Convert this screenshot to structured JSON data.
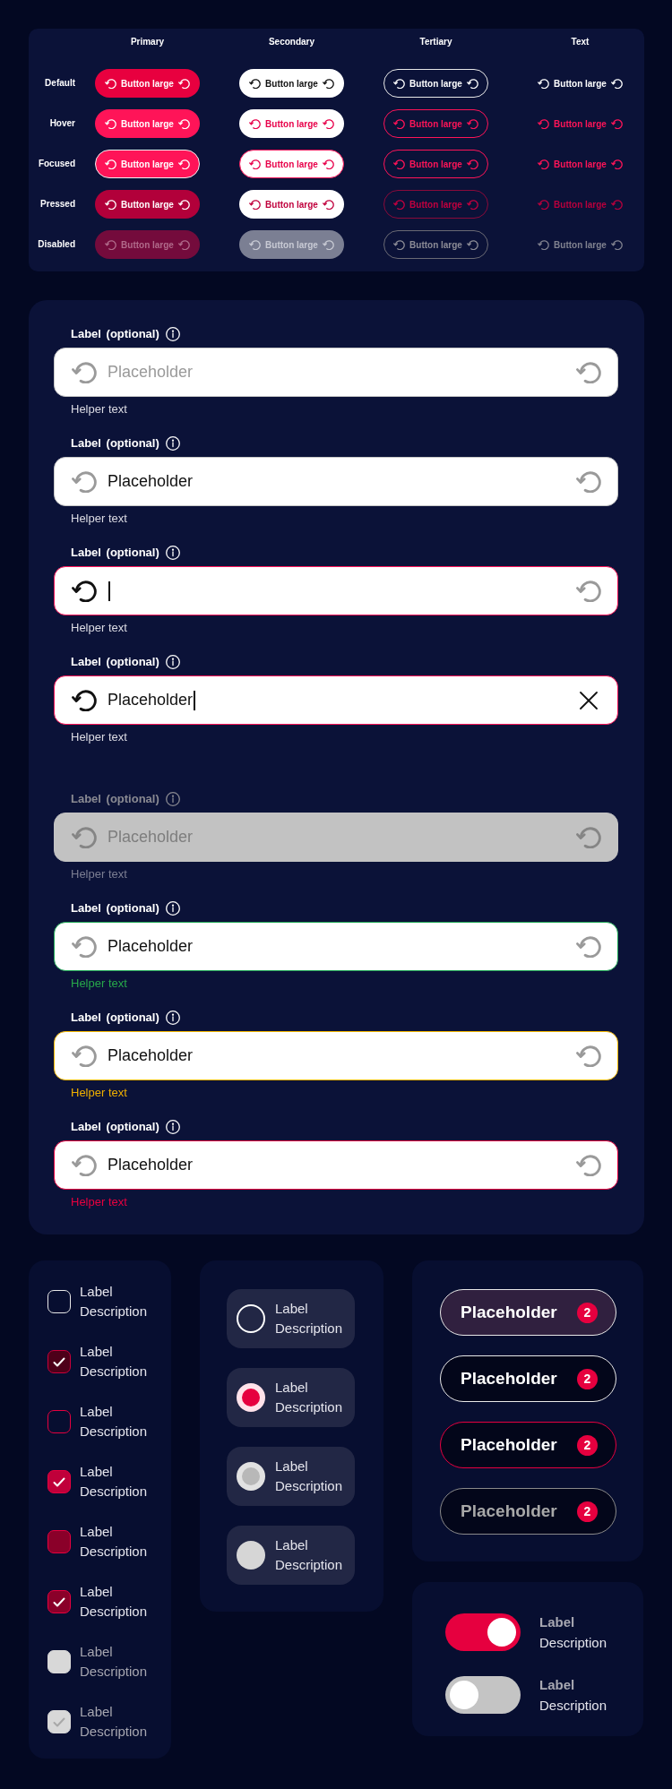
{
  "button_matrix": {
    "columns": [
      {
        "title": "Primary",
        "kind": "primary"
      },
      {
        "title": "Secondary",
        "kind": "secondary"
      },
      {
        "title": "Tertiary",
        "kind": "tertiary"
      },
      {
        "title": "Text",
        "kind": "text"
      }
    ],
    "rows": [
      {
        "label": "Default",
        "kind": "default",
        "buttons": [
          "Button large",
          "Button large",
          "Button large",
          "Button large"
        ]
      },
      {
        "label": "Hover",
        "kind": "hover",
        "buttons": [
          "Button large",
          "Button large",
          "Button large",
          "Button large"
        ]
      },
      {
        "label": "Focused",
        "kind": "focused",
        "buttons": [
          "Button large",
          "Button large",
          "Button large",
          "Button large"
        ]
      },
      {
        "label": "Pressed",
        "kind": "pressed",
        "buttons": [
          "Button large",
          "Button large",
          "Button large",
          "Button large"
        ]
      },
      {
        "label": "Disabled",
        "kind": "disabled",
        "buttons": [
          "Button large",
          "Button large",
          "Button large",
          "Button large"
        ]
      }
    ]
  },
  "text_field_groups": [
    {
      "fields": [
        {
          "label": "Label (optional)",
          "kind": "default",
          "placeholder": "Placeholder",
          "helper": "Helper text"
        },
        {
          "label": "Label (optional)",
          "kind": "filled",
          "value": "Placeholder",
          "helper": "Helper text"
        },
        {
          "label": "Label (optional)",
          "kind": "focused",
          "helper": "Helper text"
        },
        {
          "label": "Label (optional)",
          "kind": "focused",
          "value": "Placeholder",
          "helper": "Helper text"
        }
      ]
    },
    {
      "fields": [
        {
          "label": "Label (optional)",
          "kind": "disabled",
          "placeholder": "Placeholder",
          "helper": "Helper text"
        },
        {
          "label": "Label (optional)",
          "kind": "success",
          "value": "Placeholder",
          "helper": "Helper text"
        },
        {
          "label": "Label (optional)",
          "kind": "warning",
          "value": "Placeholder",
          "helper": "Helper text"
        },
        {
          "label": "Label (optional)",
          "kind": "error",
          "value": "Placeholder",
          "helper": "Helper text"
        }
      ]
    }
  ],
  "checkboxes": [
    {
      "label": "Label",
      "description": "Description",
      "checked": false,
      "kind": "default"
    },
    {
      "label": "Label",
      "description": "Description",
      "checked": true,
      "kind": "default"
    },
    {
      "label": "Label",
      "description": "Description",
      "checked": false,
      "kind": "hover"
    },
    {
      "label": "Label",
      "description": "Description",
      "checked": true,
      "kind": "hover"
    },
    {
      "label": "Label",
      "description": "Description",
      "checked": false,
      "kind": "pressed"
    },
    {
      "label": "Label",
      "description": "Description",
      "checked": true,
      "kind": "pressed"
    },
    {
      "label": "Label",
      "description": "Description",
      "checked": false,
      "kind": "disabled"
    },
    {
      "label": "Label",
      "description": "Description",
      "checked": true,
      "kind": "disabled"
    }
  ],
  "radios": [
    {
      "label": "Label",
      "description": "Description",
      "selected": false,
      "disabled": false
    },
    {
      "label": "Label",
      "description": "Description",
      "selected": true,
      "disabled": false
    },
    {
      "label": "Label",
      "description": "Description",
      "selected": true,
      "disabled": true
    },
    {
      "label": "Label",
      "description": "Description",
      "selected": false,
      "disabled": true
    }
  ],
  "chips": [
    {
      "label": "Placeholder",
      "count": "2",
      "kind": "hover"
    },
    {
      "label": "Placeholder",
      "count": "2",
      "kind": "default"
    },
    {
      "label": "Placeholder",
      "count": "2",
      "kind": "focused"
    },
    {
      "label": "Placeholder",
      "count": "2",
      "kind": "disabled"
    }
  ],
  "toggles": [
    {
      "label": "Label",
      "description": "Description",
      "on": true
    },
    {
      "label": "Label",
      "description": "Description",
      "on": false
    }
  ]
}
